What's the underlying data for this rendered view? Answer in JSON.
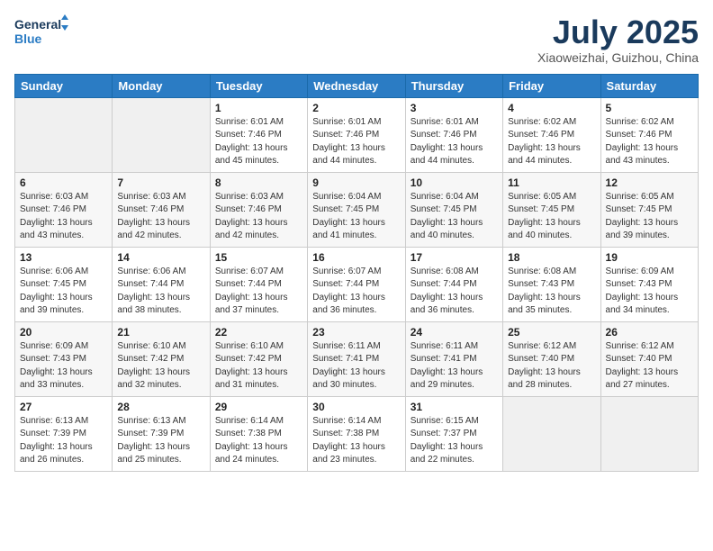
{
  "header": {
    "logo_general": "General",
    "logo_blue": "Blue",
    "month_year": "July 2025",
    "location": "Xiaoweizhai, Guizhou, China"
  },
  "weekdays": [
    "Sunday",
    "Monday",
    "Tuesday",
    "Wednesday",
    "Thursday",
    "Friday",
    "Saturday"
  ],
  "weeks": [
    [
      {
        "day": "",
        "info": ""
      },
      {
        "day": "",
        "info": ""
      },
      {
        "day": "1",
        "info": "Sunrise: 6:01 AM\nSunset: 7:46 PM\nDaylight: 13 hours and 45 minutes."
      },
      {
        "day": "2",
        "info": "Sunrise: 6:01 AM\nSunset: 7:46 PM\nDaylight: 13 hours and 44 minutes."
      },
      {
        "day": "3",
        "info": "Sunrise: 6:01 AM\nSunset: 7:46 PM\nDaylight: 13 hours and 44 minutes."
      },
      {
        "day": "4",
        "info": "Sunrise: 6:02 AM\nSunset: 7:46 PM\nDaylight: 13 hours and 44 minutes."
      },
      {
        "day": "5",
        "info": "Sunrise: 6:02 AM\nSunset: 7:46 PM\nDaylight: 13 hours and 43 minutes."
      }
    ],
    [
      {
        "day": "6",
        "info": "Sunrise: 6:03 AM\nSunset: 7:46 PM\nDaylight: 13 hours and 43 minutes."
      },
      {
        "day": "7",
        "info": "Sunrise: 6:03 AM\nSunset: 7:46 PM\nDaylight: 13 hours and 42 minutes."
      },
      {
        "day": "8",
        "info": "Sunrise: 6:03 AM\nSunset: 7:46 PM\nDaylight: 13 hours and 42 minutes."
      },
      {
        "day": "9",
        "info": "Sunrise: 6:04 AM\nSunset: 7:45 PM\nDaylight: 13 hours and 41 minutes."
      },
      {
        "day": "10",
        "info": "Sunrise: 6:04 AM\nSunset: 7:45 PM\nDaylight: 13 hours and 40 minutes."
      },
      {
        "day": "11",
        "info": "Sunrise: 6:05 AM\nSunset: 7:45 PM\nDaylight: 13 hours and 40 minutes."
      },
      {
        "day": "12",
        "info": "Sunrise: 6:05 AM\nSunset: 7:45 PM\nDaylight: 13 hours and 39 minutes."
      }
    ],
    [
      {
        "day": "13",
        "info": "Sunrise: 6:06 AM\nSunset: 7:45 PM\nDaylight: 13 hours and 39 minutes."
      },
      {
        "day": "14",
        "info": "Sunrise: 6:06 AM\nSunset: 7:44 PM\nDaylight: 13 hours and 38 minutes."
      },
      {
        "day": "15",
        "info": "Sunrise: 6:07 AM\nSunset: 7:44 PM\nDaylight: 13 hours and 37 minutes."
      },
      {
        "day": "16",
        "info": "Sunrise: 6:07 AM\nSunset: 7:44 PM\nDaylight: 13 hours and 36 minutes."
      },
      {
        "day": "17",
        "info": "Sunrise: 6:08 AM\nSunset: 7:44 PM\nDaylight: 13 hours and 36 minutes."
      },
      {
        "day": "18",
        "info": "Sunrise: 6:08 AM\nSunset: 7:43 PM\nDaylight: 13 hours and 35 minutes."
      },
      {
        "day": "19",
        "info": "Sunrise: 6:09 AM\nSunset: 7:43 PM\nDaylight: 13 hours and 34 minutes."
      }
    ],
    [
      {
        "day": "20",
        "info": "Sunrise: 6:09 AM\nSunset: 7:43 PM\nDaylight: 13 hours and 33 minutes."
      },
      {
        "day": "21",
        "info": "Sunrise: 6:10 AM\nSunset: 7:42 PM\nDaylight: 13 hours and 32 minutes."
      },
      {
        "day": "22",
        "info": "Sunrise: 6:10 AM\nSunset: 7:42 PM\nDaylight: 13 hours and 31 minutes."
      },
      {
        "day": "23",
        "info": "Sunrise: 6:11 AM\nSunset: 7:41 PM\nDaylight: 13 hours and 30 minutes."
      },
      {
        "day": "24",
        "info": "Sunrise: 6:11 AM\nSunset: 7:41 PM\nDaylight: 13 hours and 29 minutes."
      },
      {
        "day": "25",
        "info": "Sunrise: 6:12 AM\nSunset: 7:40 PM\nDaylight: 13 hours and 28 minutes."
      },
      {
        "day": "26",
        "info": "Sunrise: 6:12 AM\nSunset: 7:40 PM\nDaylight: 13 hours and 27 minutes."
      }
    ],
    [
      {
        "day": "27",
        "info": "Sunrise: 6:13 AM\nSunset: 7:39 PM\nDaylight: 13 hours and 26 minutes."
      },
      {
        "day": "28",
        "info": "Sunrise: 6:13 AM\nSunset: 7:39 PM\nDaylight: 13 hours and 25 minutes."
      },
      {
        "day": "29",
        "info": "Sunrise: 6:14 AM\nSunset: 7:38 PM\nDaylight: 13 hours and 24 minutes."
      },
      {
        "day": "30",
        "info": "Sunrise: 6:14 AM\nSunset: 7:38 PM\nDaylight: 13 hours and 23 minutes."
      },
      {
        "day": "31",
        "info": "Sunrise: 6:15 AM\nSunset: 7:37 PM\nDaylight: 13 hours and 22 minutes."
      },
      {
        "day": "",
        "info": ""
      },
      {
        "day": "",
        "info": ""
      }
    ]
  ]
}
